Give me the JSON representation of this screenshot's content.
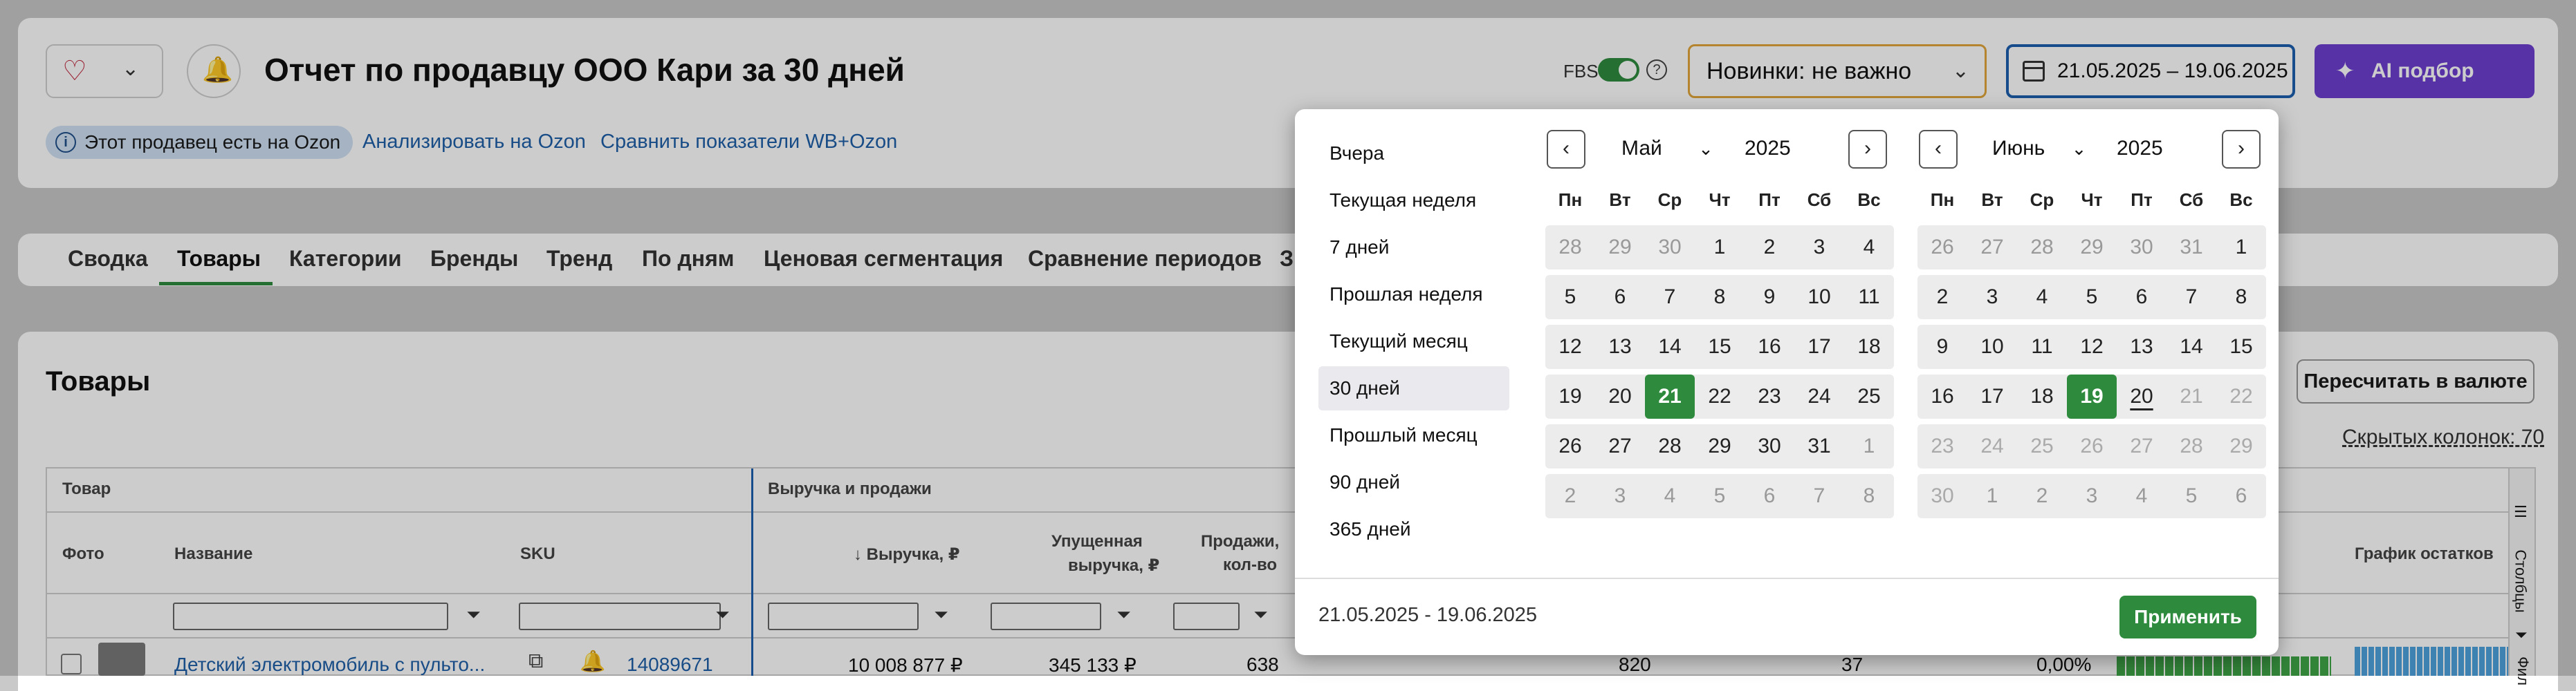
{
  "header": {
    "title": "Отчет по продавцу ООО Кари за 30 дней",
    "badge": "Этот продавец есть на Ozon",
    "link_analyze": "Анализировать на Ozon",
    "link_compare": "Сравнить показатели WB+Ozon",
    "fbs_label": "FBS",
    "new_select": "Новинки: не важно",
    "date_range": "21.05.2025 – 19.06.2025",
    "ai_button": "AI подбор ниши"
  },
  "tabs": [
    "Сводка",
    "Товары",
    "Категории",
    "Бренды",
    "Тренд",
    "По дням",
    "Ценовая сегментация",
    "Сравнение периодов",
    "З"
  ],
  "active_tab": "Товары",
  "products": {
    "title": "Товары",
    "recalc_button": "Пересчитать в валюте",
    "hidden_columns": "Скрытых колонок: 70",
    "group_product": "Товар",
    "group_revenue": "Выручка и продажи",
    "col_photo": "Фото",
    "col_name": "Название",
    "col_sku": "SKU",
    "col_revenue": "↓ Выручка, ₽",
    "col_lost_1": "Упущенная",
    "col_lost_2": "выручка, ₽",
    "col_sales_1": "Продажи,",
    "col_sales_2": "кол-во",
    "col_stock_chart": "График остатков",
    "rail_columns": "Столбцы",
    "rail_filters": "Фил",
    "row": {
      "name": "Детский электромобиль с пульто...",
      "sku": "14089671",
      "revenue": "10 008 877 ₽",
      "lost": "345 133 ₽",
      "sales": "638",
      "v1": "820",
      "v2": "37",
      "v3": "0,00%"
    }
  },
  "datepicker": {
    "presets": [
      "Вчера",
      "Текущая неделя",
      "7 дней",
      "Прошлая неделя",
      "Текущий месяц",
      "30 дней",
      "Прошлый месяц",
      "90 дней",
      "365 дней"
    ],
    "selected_preset": "30 дней",
    "weekdays": [
      "Пн",
      "Вт",
      "Ср",
      "Чт",
      "Пт",
      "Сб",
      "Вс"
    ],
    "left": {
      "month": "Май",
      "year": "2025",
      "weeks": [
        [
          "28",
          "29",
          "30",
          "1",
          "2",
          "3",
          "4"
        ],
        [
          "5",
          "6",
          "7",
          "8",
          "9",
          "10",
          "11"
        ],
        [
          "12",
          "13",
          "14",
          "15",
          "16",
          "17",
          "18"
        ],
        [
          "19",
          "20",
          "21",
          "22",
          "23",
          "24",
          "25"
        ],
        [
          "26",
          "27",
          "28",
          "29",
          "30",
          "31",
          "1"
        ],
        [
          "2",
          "3",
          "4",
          "5",
          "6",
          "7",
          "8"
        ]
      ],
      "selected_day": "21"
    },
    "right": {
      "month": "Июнь",
      "year": "2025",
      "weeks": [
        [
          "26",
          "27",
          "28",
          "29",
          "30",
          "31",
          "1"
        ],
        [
          "2",
          "3",
          "4",
          "5",
          "6",
          "7",
          "8"
        ],
        [
          "9",
          "10",
          "11",
          "12",
          "13",
          "14",
          "15"
        ],
        [
          "16",
          "17",
          "18",
          "19",
          "20",
          "21",
          "22"
        ],
        [
          "23",
          "24",
          "25",
          "26",
          "27",
          "28",
          "29"
        ],
        [
          "30",
          "1",
          "2",
          "3",
          "4",
          "5",
          "6"
        ]
      ],
      "selected_day": "19",
      "today": "20"
    },
    "range_text": "21.05.2025 - 19.06.2025",
    "apply_button": "Применить",
    "prev_icon": "‹",
    "next_icon": "›"
  },
  "colors": {
    "accent_green": "#2e8b3e",
    "ai_purple": "#6d3fd1",
    "link_blue": "#1f5fa8",
    "select_border": "#e1a73a"
  }
}
